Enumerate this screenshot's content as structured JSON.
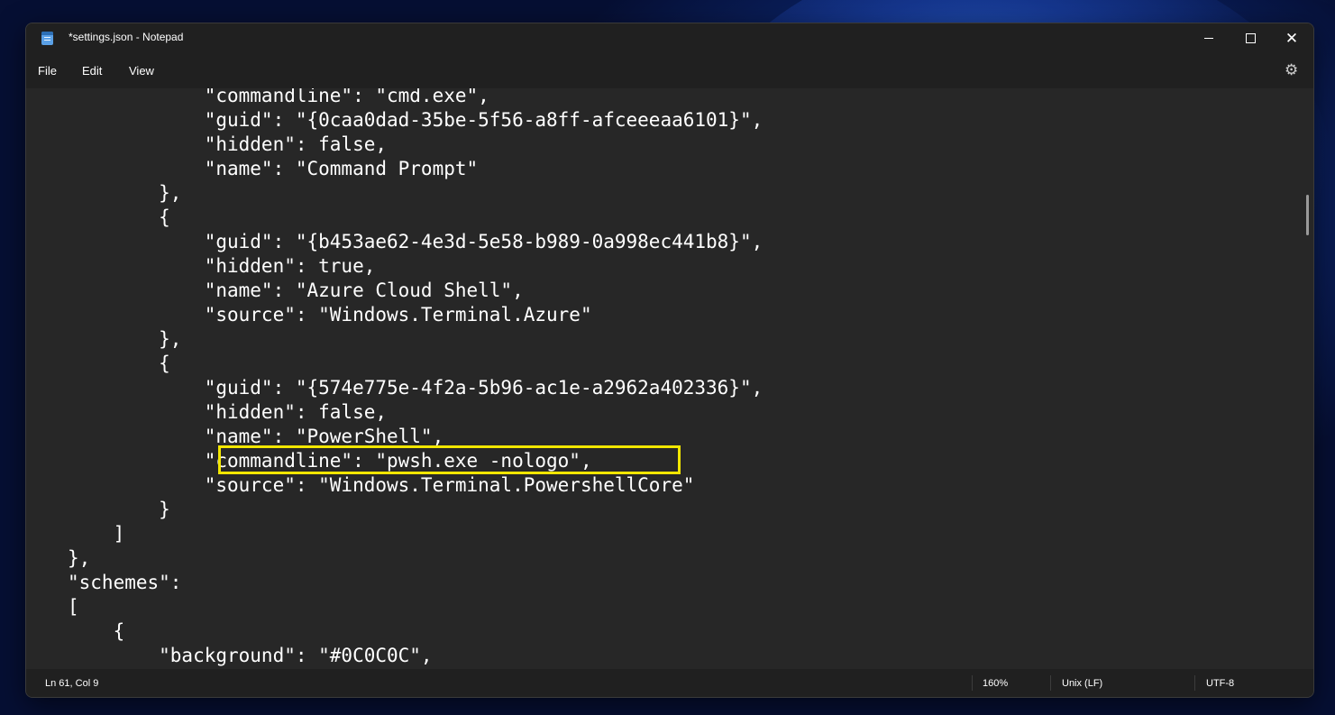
{
  "window": {
    "title": "*settings.json - Notepad"
  },
  "menu": {
    "file": "File",
    "edit": "Edit",
    "view": "View"
  },
  "editor": {
    "lines": [
      "            \"commandline\": \"cmd.exe\",",
      "            \"guid\": \"{0caa0dad-35be-5f56-a8ff-afceeeaa6101}\",",
      "            \"hidden\": false,",
      "            \"name\": \"Command Prompt\"",
      "        },",
      "        {",
      "            \"guid\": \"{b453ae62-4e3d-5e58-b989-0a998ec441b8}\",",
      "            \"hidden\": true,",
      "            \"name\": \"Azure Cloud Shell\",",
      "            \"source\": \"Windows.Terminal.Azure\"",
      "        },",
      "        {",
      "            \"guid\": \"{574e775e-4f2a-5b96-ac1e-a2962a402336}\",",
      "            \"hidden\": false,",
      "            \"name\": \"PowerShell\",",
      "            \"commandline\": \"pwsh.exe -nologo\",",
      "            \"source\": \"Windows.Terminal.PowershellCore\"",
      "        }",
      "    ]",
      "},",
      "\"schemes\":",
      "[",
      "    {",
      "        \"background\": \"#0C0C0C\","
    ]
  },
  "status": {
    "position": "Ln 61, Col 9",
    "zoom": "160%",
    "line_ending": "Unix (LF)",
    "encoding": "UTF-8"
  },
  "icons": {
    "app": "notepad-icon",
    "minimize": "minimize-icon",
    "maximize": "maximize-icon",
    "close": "close-icon",
    "settings": "gear-icon"
  },
  "colors": {
    "highlight": "#f2e600",
    "editor_bg": "#272727",
    "chrome_bg": "#202020"
  }
}
